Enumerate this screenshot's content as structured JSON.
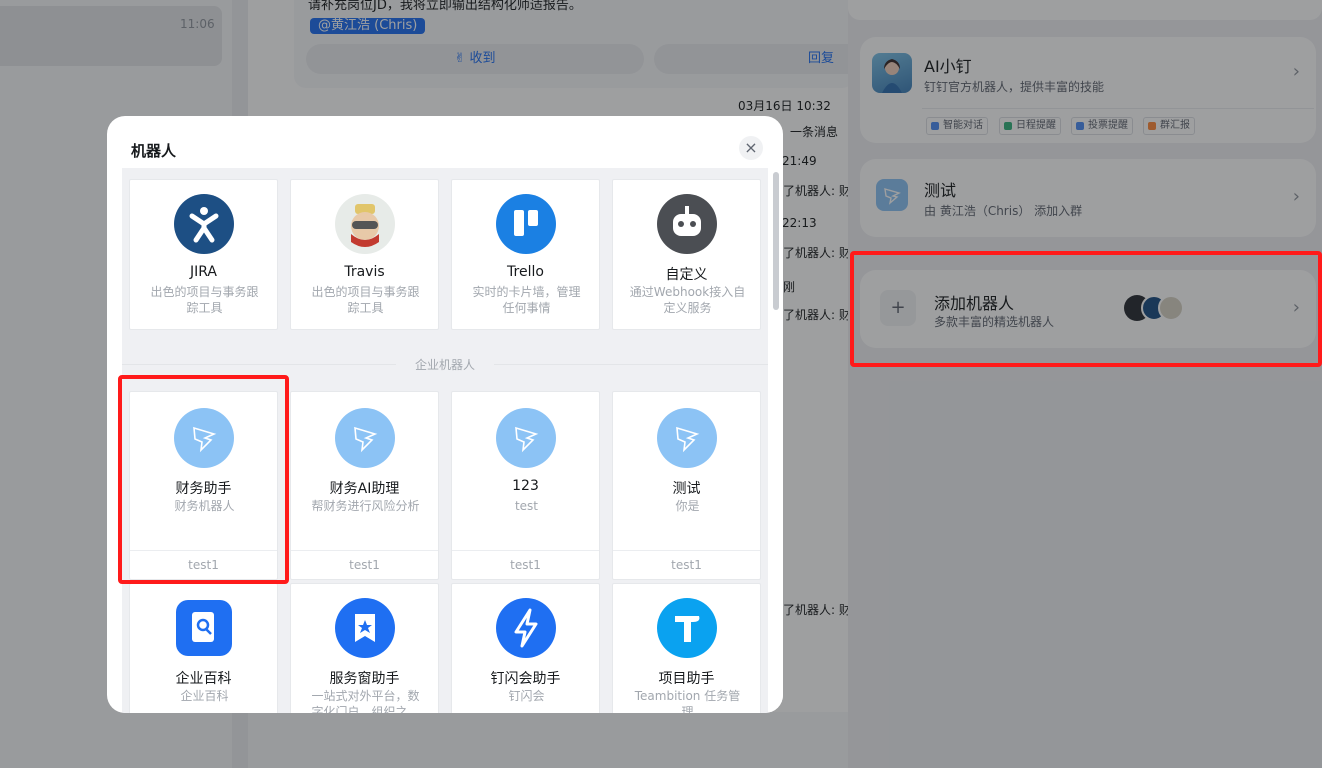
{
  "background": {
    "conversation_time": "11:06",
    "message_text": "请补充岗位JD，我将立即输出结构化师适报告。",
    "mention": "@黄江浩 (Chris)",
    "ack_button": "收到",
    "reply_button": "回复",
    "notes": [
      "03月16日 10:32",
      "一条消息",
      "21:49",
      "了机器人: 财务",
      "22:13",
      "了机器人: 财务",
      "刚",
      "了机器人: 财务",
      "了机器人: 财务"
    ]
  },
  "right_panel": {
    "ai": {
      "title": "AI小钉",
      "subtitle": "钉钉官方机器人，提供丰富的技能",
      "tags": [
        "智能对话",
        "日程提醒",
        "投票提醒",
        "群汇报"
      ]
    },
    "test": {
      "title": "测试",
      "subtitle": "由 黄江浩（Chris） 添加入群"
    },
    "add": {
      "title": "添加机器人",
      "subtitle": "多款丰富的精选机器人"
    }
  },
  "modal": {
    "title": "机器人",
    "close": "×",
    "section_label": "企业机器人",
    "top_bots": [
      {
        "name": "JIRA",
        "desc": "出色的项目与事务跟踪工具",
        "icon": "jira-icon"
      },
      {
        "name": "Travis",
        "desc": "出色的项目与事务跟踪工具",
        "icon": "travis-icon"
      },
      {
        "name": "Trello",
        "desc": "实时的卡片墙，管理任何事情",
        "icon": "trello-icon"
      },
      {
        "name": "自定义",
        "desc": "通过Webhook接入自定义服务",
        "icon": "custom-robot-icon"
      }
    ],
    "enterprise_bots": [
      {
        "name": "财务助手",
        "desc": "财务机器人",
        "foot": "test1",
        "icon": "dingtalk-icon"
      },
      {
        "name": "财务AI助理",
        "desc": "帮财务进行风险分析",
        "foot": "test1",
        "icon": "dingtalk-icon"
      },
      {
        "name": "123",
        "desc": "test",
        "foot": "test1",
        "icon": "dingtalk-icon"
      },
      {
        "name": "测试",
        "desc": "你是",
        "foot": "test1",
        "icon": "dingtalk-icon"
      }
    ],
    "more_bots": [
      {
        "name": "企业百科",
        "desc": "企业百科",
        "icon": "encyclopedia-icon"
      },
      {
        "name": "服务窗助手",
        "desc": "一站式对外平台，数字化门户，组织之…",
        "icon": "service-window-icon"
      },
      {
        "name": "钉闪会助手",
        "desc": "钉闪会",
        "icon": "lightning-icon"
      },
      {
        "name": "项目助手",
        "desc": "Teambition 任务管理",
        "icon": "teambition-icon"
      }
    ]
  },
  "colors": {
    "accent": "#1f6ff2",
    "highlight": "#ff1a1a",
    "jira": "#1d4f84",
    "trello": "#1b80e3",
    "custom": "#4b4e53",
    "dingtalk": "#8cc3f5"
  }
}
